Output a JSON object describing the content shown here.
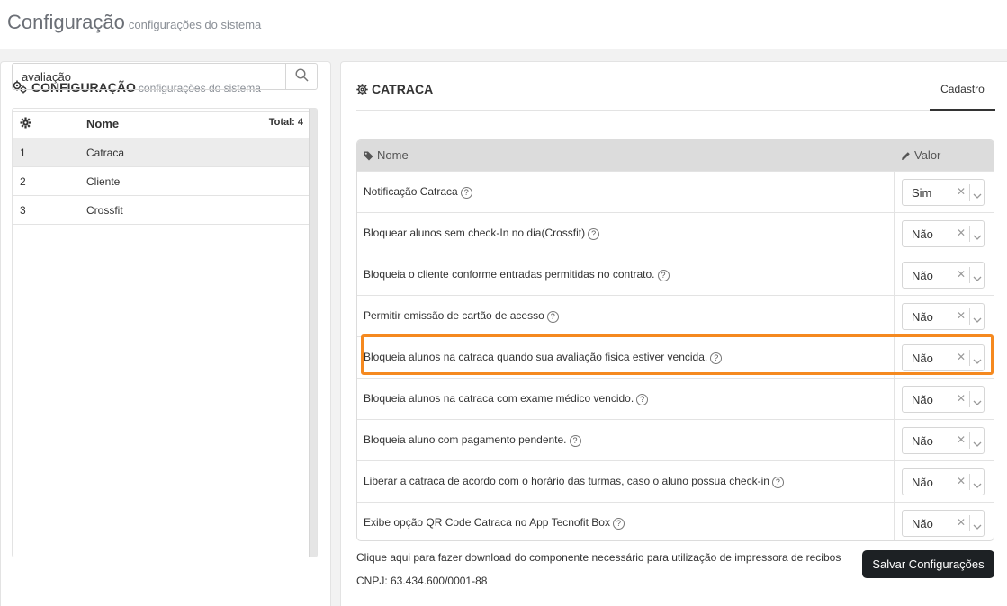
{
  "page": {
    "title": "Configuração",
    "subtitle": "configurações do sistema"
  },
  "left_panel": {
    "title": "CONFIGURAÇÃO",
    "subtitle": "configurações do sistema",
    "search": {
      "value": "avaliação"
    },
    "list": {
      "header": {
        "col_name": "Nome",
        "total": "Total: 4"
      },
      "rows": [
        {
          "num": "1",
          "name": "Catraca"
        },
        {
          "num": "2",
          "name": "Cliente"
        },
        {
          "num": "3",
          "name": "Crossfit"
        }
      ]
    }
  },
  "right_panel": {
    "title": "CATRACA",
    "tab": "Cadastro",
    "table": {
      "col_name": "Nome",
      "col_value": "Valor",
      "rows": [
        {
          "label": "Notificação Catraca",
          "value": "Sim"
        },
        {
          "label": "Bloquear alunos sem check-In no dia(Crossfit)",
          "value": "Não"
        },
        {
          "label": "Bloqueia o cliente conforme entradas permitidas no contrato.",
          "value": "Não"
        },
        {
          "label": "Permitir emissão de cartão de acesso",
          "value": "Não"
        },
        {
          "label": "Bloqueia alunos na catraca quando sua avaliação fisica estiver vencida.",
          "value": "Não"
        },
        {
          "label": "Bloqueia alunos na catraca com exame médico vencido.",
          "value": "Não"
        },
        {
          "label": "Bloqueia aluno com pagamento pendente.",
          "value": "Não"
        },
        {
          "label": "Liberar a catraca de acordo com o horário das turmas, caso o aluno possua check-in",
          "value": "Não"
        },
        {
          "label": "Exibe opção QR Code Catraca no App Tecnofit Box",
          "value": "Não"
        }
      ]
    },
    "footer": {
      "download_link": "Clique aqui para fazer download do componente necessário para utilização de impressora de recibos",
      "cnpj": "CNPJ: 63.434.600/0001-88",
      "save_label": "Salvar Configurações"
    }
  },
  "colors": {
    "highlight": "#f5891f",
    "save_button": "#1d2124",
    "table_header": "#dcdcdc"
  }
}
